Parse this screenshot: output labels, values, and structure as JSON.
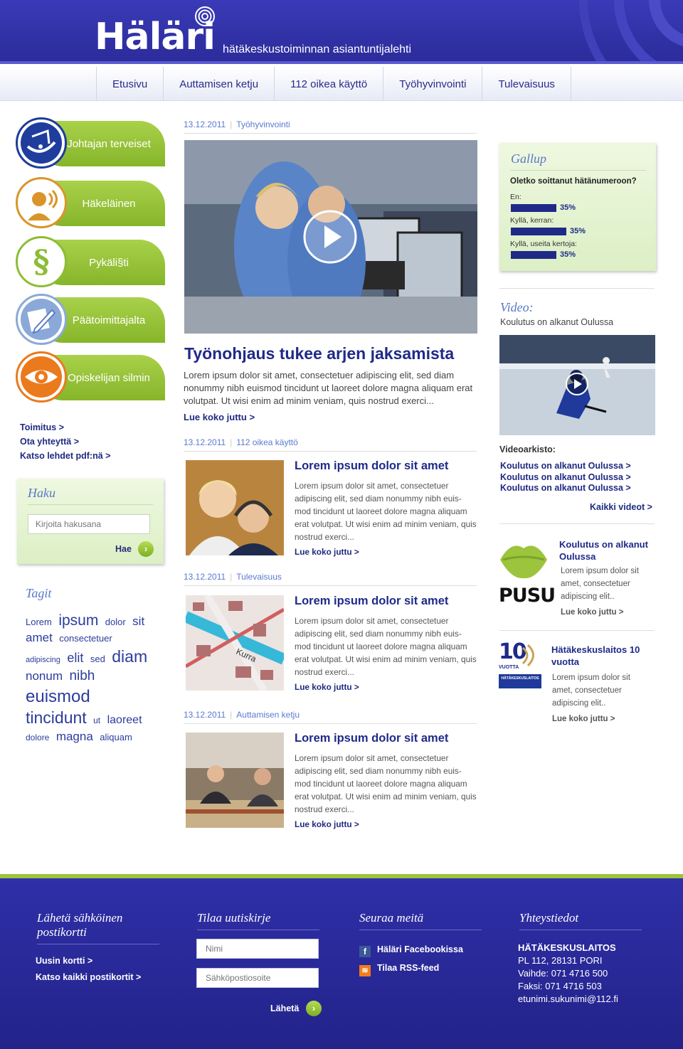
{
  "header": {
    "logo": "Häläri",
    "tagline": "hätäkeskustoiminnan asiantuntijalehti"
  },
  "nav": [
    "Etusivu",
    "Auttamisen ketju",
    "112 oikea käyttö",
    "Työhyvinvointi",
    "Tulevaisuus"
  ],
  "categories": [
    {
      "label": "Johtajan terveiset",
      "icon": "dish-icon",
      "color": "#1f3d9c"
    },
    {
      "label": "Häkeläinen",
      "icon": "headset-operator-icon",
      "color": "#d9952a"
    },
    {
      "label": "Pykäli§ti",
      "icon": "paragraph-icon",
      "color": "#8cbd35"
    },
    {
      "label": "Päätoimittajalta",
      "icon": "pen-icon",
      "color": "#8ba9d8"
    },
    {
      "label": "Opiskelijan silmin",
      "icon": "eye-icon",
      "color": "#ea7a1c"
    }
  ],
  "left_links": [
    "Toimitus >",
    "Ota yhteyttä >",
    "Katso lehdet pdf:nä >"
  ],
  "search": {
    "title": "Haku",
    "placeholder": "Kirjoita hakusana",
    "button": "Hae"
  },
  "tags": {
    "title": "Tagit",
    "items": [
      {
        "t": "Lorem",
        "s": 13
      },
      {
        "t": "ipsum",
        "s": 21
      },
      {
        "t": "dolor",
        "s": 13
      },
      {
        "t": "sit",
        "s": 17
      },
      {
        "t": "amet",
        "s": 17
      },
      {
        "t": "consectetuer",
        "s": 13
      },
      {
        "t": "adipiscing",
        "s": 11
      },
      {
        "t": "elit",
        "s": 18
      },
      {
        "t": "sed",
        "s": 13
      },
      {
        "t": "diam",
        "s": 23
      },
      {
        "t": "nonum",
        "s": 17
      },
      {
        "t": "nibh",
        "s": 19
      },
      {
        "t": "euismod",
        "s": 24
      },
      {
        "t": "tincidunt",
        "s": 23
      },
      {
        "t": "ut",
        "s": 12
      },
      {
        "t": "laoreet",
        "s": 16
      },
      {
        "t": "dolore",
        "s": 12
      },
      {
        "t": "magna",
        "s": 17
      },
      {
        "t": "aliquam",
        "s": 13
      }
    ]
  },
  "hero": {
    "date": "13.12.2011",
    "category": "Työhyvinvointi",
    "title": "Työnohjaus tukee arjen jaksamista",
    "body": "Lorem ipsum dolor sit amet, consectetuer adipiscing elit, sed diam nonummy nibh euismod tincidunt ut laoreet dolore magna aliquam erat volutpat. Ut wisi enim ad minim veniam, quis nostrud exerci...",
    "more": "Lue koko juttu >"
  },
  "articles": [
    {
      "date": "13.12.2011",
      "category": "112 oikea käyttö",
      "title": "Lorem ipsum dolor sit amet",
      "body": "Lorem ipsum dolor sit amet, consectetuer adipiscing elit, sed diam nonummy nibh euis-mod tincidunt ut laoreet dolore magna aliquam erat volutpat. Ut wisi enim ad minim veniam, quis nostrud exerci...",
      "more": "Lue koko juttu >"
    },
    {
      "date": "13.12.2011",
      "category": "Tulevaisuus",
      "title": "Lorem ipsum dolor sit amet",
      "body": "Lorem ipsum dolor sit amet, consectetuer adipiscing elit, sed diam nonummy nibh euis-mod tincidunt ut laoreet dolore magna aliquam erat volutpat. Ut wisi enim ad minim veniam, quis nostrud exerci...",
      "more": "Lue koko juttu >"
    },
    {
      "date": "13.12.2011",
      "category": "Auttamisen ketju",
      "title": "Lorem ipsum dolor sit amet",
      "body": "Lorem ipsum dolor sit amet, consectetuer adipiscing elit, sed diam nonummy nibh euis-mod tincidunt ut laoreet dolore magna aliquam erat volutpat. Ut wisi enim ad minim veniam, quis nostrud exerci...",
      "more": "Lue koko juttu >"
    }
  ],
  "gallup": {
    "title": "Gallup",
    "question": "Oletko soittanut hätänumeroon?",
    "options": [
      {
        "label": "En:",
        "pct": "35%",
        "share": 0.35
      },
      {
        "label": "Kyllä, kerran:",
        "pct": "35%",
        "share": 0.35
      },
      {
        "label": "Kyllä, useita kertoja:",
        "pct": "35%",
        "share": 0.35
      }
    ]
  },
  "video": {
    "title": "Video:",
    "subtitle": "Koulutus on alkanut Oulussa",
    "archive_label": "Videoarkisto:",
    "archive": [
      "Koulutus on alkanut Oulussa >",
      "Koulutus on alkanut Oulussa >",
      "Koulutus on alkanut Oulussa >"
    ],
    "all": "Kaikki videot >"
  },
  "promos": [
    {
      "logo_text": "PUSU",
      "title": "Koulutus on alkanut Oulussa",
      "body": "Lorem ipsum dolor sit amet, consectetuer adipiscing elit..",
      "more": "Lue koko juttu >"
    },
    {
      "logo_text": "10",
      "logo_sub": "VUOTTA",
      "logo_badge": "HÄTÄKESKUSLAITOS",
      "title": "Hätäkeskuslaitos 10 vuotta",
      "body": "Lorem ipsum dolor sit amet, consectetuer adipiscing elit..",
      "more": "Lue koko juttu >"
    }
  ],
  "footer": {
    "postcard": {
      "title": "Lähetä sähköinen postikortti",
      "links": [
        "Uusin kortti >",
        "Katso kaikki postikortit >"
      ]
    },
    "newsletter": {
      "title": "Tilaa uutiskirje",
      "name_placeholder": "Nimi",
      "email_placeholder": "Sähköpostiosoite",
      "send": "Lähetä"
    },
    "follow": {
      "title": "Seuraa meitä",
      "facebook": "Häläri Facebookissa",
      "rss": "Tilaa RSS-feed"
    },
    "contact": {
      "title": "Yhteystiedot",
      "org": "HÄTÄKESKUSLAITOS",
      "address": "PL 112, 28131 PORI",
      "phone": "Vaihde: 071 4716 500",
      "fax": "Faksi: 071 4716 503",
      "email": "etunimi.sukunimi@112.fi"
    }
  }
}
